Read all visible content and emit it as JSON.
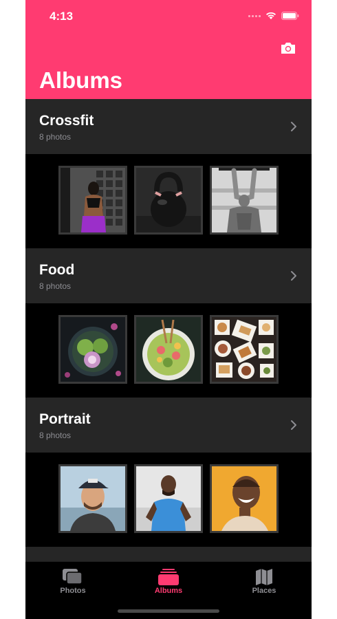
{
  "status_bar": {
    "time": "4:13"
  },
  "header": {
    "title": "Albums",
    "action_icon": "camera-icon"
  },
  "albums": [
    {
      "name": "Crossfit",
      "count": "8 photos",
      "thumbnails": [
        "crossfit-woman-photo",
        "kettlebell-photo",
        "man-pullup-photo"
      ]
    },
    {
      "name": "Food",
      "count": "8 photos",
      "thumbnails": [
        "vegetable-bowl-photo",
        "salad-bowl-photo",
        "dishes-table-photo"
      ]
    },
    {
      "name": "Portrait",
      "count": "8 photos",
      "thumbnails": [
        "man-cap-photo",
        "man-blue-shirt-photo",
        "woman-laughing-photo"
      ]
    }
  ],
  "tab_bar": [
    {
      "label": "Photos",
      "icon": "photos-icon",
      "active": false
    },
    {
      "label": "Albums",
      "icon": "albums-icon",
      "active": true
    },
    {
      "label": "Places",
      "icon": "map-icon",
      "active": false
    }
  ],
  "colors": {
    "accent": "#ff3b71",
    "row_background": "#262626",
    "background": "#000000",
    "muted_text": "#8e8e93"
  }
}
